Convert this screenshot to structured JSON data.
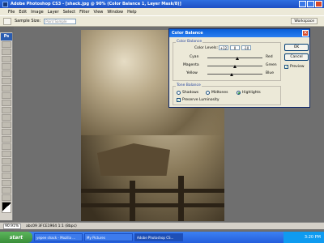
{
  "window": {
    "title": "Adobe Photoshop CS3 - [shack.jpg @ 90% (Color Balance 1, Layer Mask/8)]"
  },
  "menu": [
    "File",
    "Edit",
    "Image",
    "Layer",
    "Select",
    "Filter",
    "View",
    "Window",
    "Help"
  ],
  "options_bar": {
    "sample_size_label": "Sample Size:",
    "sample_size_value": "Point Sample",
    "workspace_label": "Workspace"
  },
  "document": {
    "zoom": "90.91%",
    "status": "abc09 3FCE1964 1:1 (8bpc)"
  },
  "dialog": {
    "title": "Color Balance",
    "color_balance_legend": "Color Balance",
    "color_levels_label": "Color Levels:",
    "levels": [
      "+12",
      "0",
      "-10"
    ],
    "sliders": [
      {
        "left": "Cyan",
        "right": "Red",
        "value": 12
      },
      {
        "left": "Magenta",
        "right": "Green",
        "value": 0
      },
      {
        "left": "Yellow",
        "right": "Blue",
        "value": -10
      }
    ],
    "tone_balance_legend": "Tone Balance",
    "tones": [
      "Shadows",
      "Midtones",
      "Highlights"
    ],
    "selected_tone": "Highlights",
    "preserve_luminosity": "Preserve Luminosity",
    "ok": "OK",
    "cancel": "Cancel",
    "preview": "Preview"
  },
  "taskbar": {
    "start": "start",
    "tasks": [
      "yepee shack - Mozilla ...",
      "My Pictures",
      "Adobe Photoshop CS..."
    ],
    "clock": "3:20 PM"
  }
}
